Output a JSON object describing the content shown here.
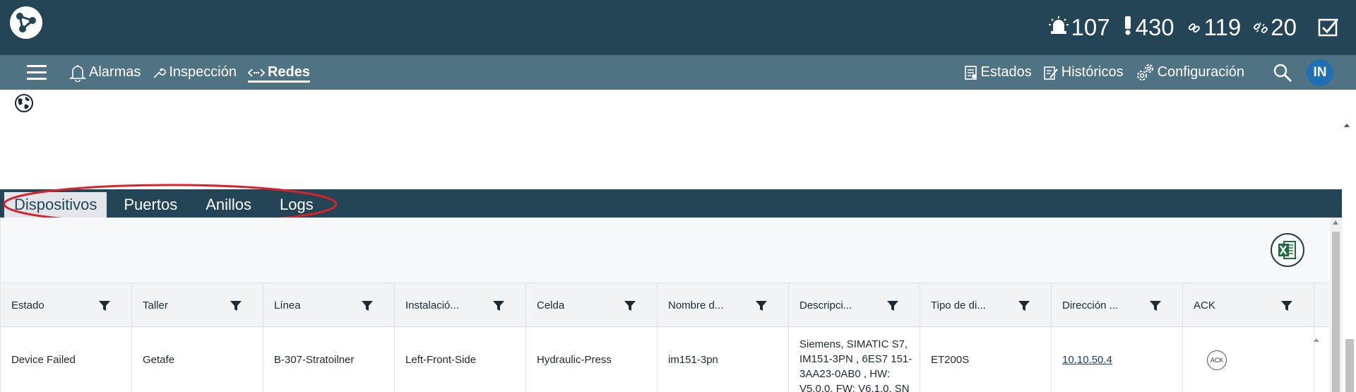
{
  "topbar": {
    "counters": [
      {
        "icon": "siren-icon",
        "value": "107"
      },
      {
        "icon": "exclamation-icon",
        "value": "430"
      },
      {
        "icon": "link-icon",
        "value": "119"
      },
      {
        "icon": "broken-link-icon",
        "value": "20"
      }
    ]
  },
  "nav": {
    "left": [
      {
        "icon": "bell-icon",
        "label": "Alarmas"
      },
      {
        "icon": "wrench-icon",
        "label": "Inspección"
      },
      {
        "icon": "network-arrows-icon",
        "label": "Redes",
        "active": true
      }
    ],
    "right": [
      {
        "icon": "clipboard-icon",
        "label": "Estados"
      },
      {
        "icon": "edit-list-icon",
        "label": "Históricos"
      },
      {
        "icon": "gears-icon",
        "label": "Configuración"
      }
    ],
    "avatar": "IN"
  },
  "tabs": [
    "Dispositivos",
    "Puertos",
    "Anillos",
    "Logs"
  ],
  "grid": {
    "columns": [
      "Estado",
      "Taller",
      "Línea",
      "Instalació...",
      "Celda",
      "Nombre d...",
      "Descripci...",
      "Tipo de di...",
      "Dirección ...",
      "ACK"
    ],
    "row": {
      "estado": "Device Failed",
      "taller": "Getafe",
      "linea": "B-307-Stratoilner",
      "instalacion": "Left-Front-Side",
      "celda": "Hydraulic-Press",
      "nombre": "im151-3pn",
      "descripcion": "Siemens, SIMATIC S7, IM151-3PN , 6ES7 151-3AA23-0AB0 , HW: V5.0.0, FW: V6.1.0, SN",
      "tipo": "ET200S",
      "direccion": "10.10.50.4",
      "ack": "ACK"
    }
  },
  "colors": {
    "topbar": "#234556",
    "navbar": "#4f7383",
    "avatar": "#1f6fb2",
    "highlight_ellipse": "#d9222a"
  }
}
